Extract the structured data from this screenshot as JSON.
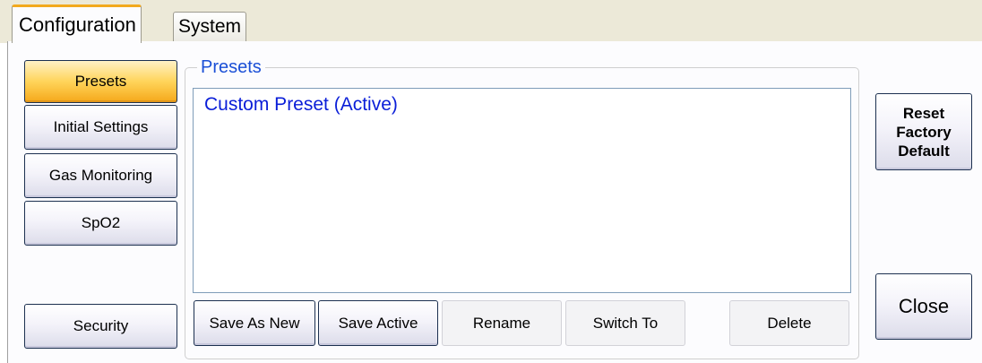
{
  "tabs": [
    {
      "label": "Configuration",
      "active": true
    },
    {
      "label": "System",
      "active": false
    }
  ],
  "sidebar": {
    "items": [
      {
        "label": "Presets",
        "selected": true
      },
      {
        "label": "Initial Settings"
      },
      {
        "label": "Gas Monitoring"
      },
      {
        "label": "SpO2"
      }
    ],
    "security_label": "Security"
  },
  "presets": {
    "group_title": "Presets",
    "list": [
      {
        "label": "Custom Preset (Active)"
      }
    ],
    "actions": {
      "save_as_new": "Save As New",
      "save_active": "Save Active",
      "rename": "Rename",
      "switch_to": "Switch To",
      "delete": "Delete"
    }
  },
  "right_panel": {
    "reset_line1": "Reset",
    "reset_line2": "Factory",
    "reset_line3": "Default",
    "close_label": "Close"
  },
  "colors": {
    "accent_selected": "#ffd45a",
    "group_title_text": "#1a4fd6",
    "list_item_text": "#0a1ed8"
  }
}
